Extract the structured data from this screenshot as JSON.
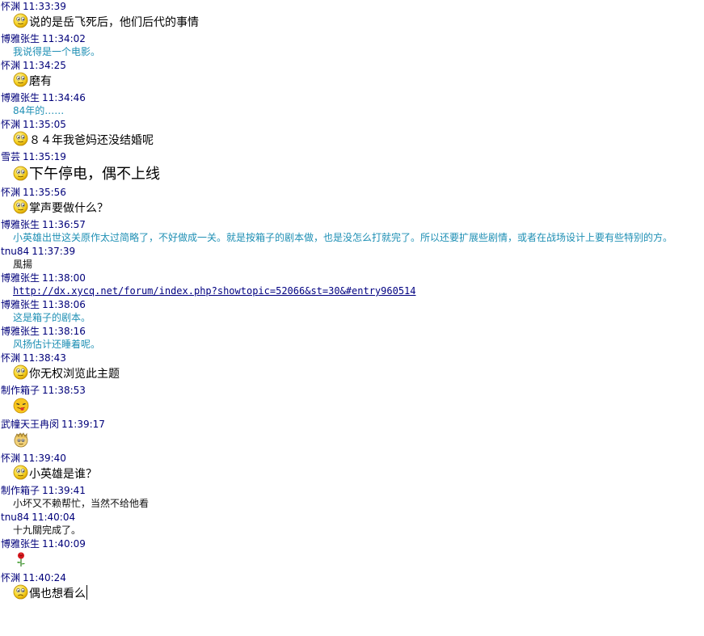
{
  "messages": [
    {
      "sender": "怀渊",
      "time": "11:33:39",
      "text": "说的是岳飞死后，他们后代的事情",
      "icon": "smiley-face-icon",
      "style": "sz14 serif"
    },
    {
      "sender": "博雅张生",
      "time": "11:34:02",
      "text": "我说得是一个电影。",
      "style": "sz12 blue"
    },
    {
      "sender": "怀渊",
      "time": "11:34:25",
      "text": "磨有",
      "icon": "smiley-face-icon",
      "style": "sz14 serif"
    },
    {
      "sender": "博雅张生",
      "time": "11:34:46",
      "text": "84年的……",
      "style": "sz12 blue"
    },
    {
      "sender": "怀渊",
      "time": "11:35:05",
      "text": "８４年我爸妈还没结婚呢",
      "icon": "smiley-face-icon",
      "style": "sz14 serif"
    },
    {
      "sender": "雪芸",
      "time": "11:35:19",
      "text": "下午停电，偶不上线",
      "icon": "smiley-face-icon",
      "style": "sz18"
    },
    {
      "sender": "怀渊",
      "time": "11:35:56",
      "text": "掌声要做什么？",
      "icon": "smiley-face-icon",
      "style": "sz14 serif"
    },
    {
      "sender": "博雅张生",
      "time": "11:36:57",
      "text": "小英雄出世这关原作太过简略了，不好做成一关。就是按箱子的剧本做，也是没怎么打就完了。所以还要扩展些剧情，或者在战场设计上要有些特别的方。",
      "style": "sz12 blue"
    },
    {
      "sender": "tnu84",
      "time": "11:37:39",
      "text": "風揚",
      "style": "sz12 dark"
    },
    {
      "sender": "博雅张生",
      "time": "11:38:00",
      "text": "http://dx.xycq.net/forum/index.php?showtopic=52066&st=30&#entry960514",
      "style": "link"
    },
    {
      "sender": "博雅张生",
      "time": "11:38:06",
      "text": "这是箱子的剧本。",
      "style": "sz12 blue"
    },
    {
      "sender": "博雅张生",
      "time": "11:38:16",
      "text": "风扬估计还睡着呢。",
      "style": "sz12 blue"
    },
    {
      "sender": "怀渊",
      "time": "11:38:43",
      "text": "你无权浏览此主题",
      "icon": "smiley-face-icon",
      "style": "sz14 serif"
    },
    {
      "sender": "制作箱子",
      "time": "11:38:53",
      "text": "",
      "icon": "tongue-wink-face-icon",
      "style": "icononly"
    },
    {
      "sender": "武幢天王冉闵",
      "time": "11:39:17",
      "text": "",
      "icon": "hairy-monster-face-icon",
      "style": "icononly"
    },
    {
      "sender": "怀渊",
      "time": "11:39:40",
      "text": "小英雄是谁？",
      "icon": "smiley-face-icon",
      "style": "sz14 serif"
    },
    {
      "sender": "制作箱子",
      "time": "11:39:41",
      "text": "小坏又不赖帮忙，当然不给他看",
      "style": "sz12 dark"
    },
    {
      "sender": "tnu84",
      "time": "11:40:04",
      "text": "十九關完成了。",
      "style": "sz12 dark"
    },
    {
      "sender": "博雅张生",
      "time": "11:40:09",
      "text": "",
      "icon": "rose-icon",
      "style": "icononly"
    },
    {
      "sender": "怀渊",
      "time": "11:40:24",
      "text": "偶也想看么",
      "icon": "sad-face-icon",
      "style": "sz14 serif",
      "cursor": true
    }
  ],
  "colors": {
    "sender": "#00007a",
    "blue_text": "#1e8fb4",
    "link": "#000080"
  }
}
